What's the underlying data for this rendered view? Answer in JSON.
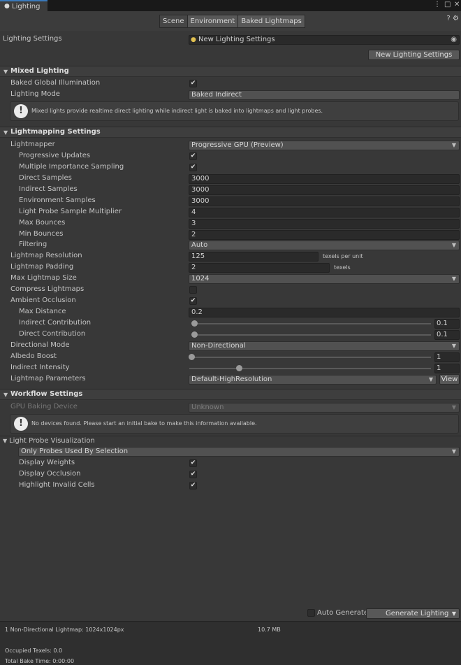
{
  "window": {
    "tab_title": "Lighting",
    "controls": [
      "⋮",
      "□",
      "✕"
    ]
  },
  "toolbar": {
    "tabs": [
      "Scene",
      "Environment",
      "Baked Lightmaps"
    ],
    "active": 0,
    "help_icon": "?",
    "settings_icon": "⚙"
  },
  "lighting_settings": {
    "label": "Lighting Settings",
    "value": "New Lighting Settings",
    "new_button": "New Lighting Settings"
  },
  "mixed": {
    "title": "Mixed Lighting",
    "baked_gi_label": "Baked Global Illumination",
    "baked_gi_checked": "✔",
    "mode_label": "Lighting Mode",
    "mode_value": "Baked Indirect",
    "help": "Mixed lights provide realtime direct lighting while indirect light is baked into lightmaps and light probes."
  },
  "lightmapping": {
    "title": "Lightmapping Settings",
    "lightmapper_label": "Lightmapper",
    "lightmapper_value": "Progressive GPU (Preview)",
    "progressive_label": "Progressive Updates",
    "progressive_checked": "✔",
    "mis_label": "Multiple Importance Sampling",
    "mis_checked": "✔",
    "direct_samples_label": "Direct Samples",
    "direct_samples": "3000",
    "indirect_samples_label": "Indirect Samples",
    "indirect_samples": "3000",
    "env_samples_label": "Environment Samples",
    "env_samples": "3000",
    "probe_mult_label": "Light Probe Sample Multiplier",
    "probe_mult": "4",
    "max_bounces_label": "Max Bounces",
    "max_bounces": "3",
    "min_bounces_label": "Min Bounces",
    "min_bounces": "2",
    "filtering_label": "Filtering",
    "filtering_value": "Auto",
    "resolution_label": "Lightmap Resolution",
    "resolution": "125",
    "resolution_unit": "texels per unit",
    "padding_label": "Lightmap Padding",
    "padding": "2",
    "padding_unit": "texels",
    "max_size_label": "Max Lightmap Size",
    "max_size": "1024",
    "compress_label": "Compress Lightmaps",
    "compress_checked": "",
    "ao_label": "Ambient Occlusion",
    "ao_checked": "✔",
    "max_distance_label": "Max Distance",
    "max_distance": "0.2",
    "indirect_contrib_label": "Indirect Contribution",
    "indirect_contrib": "0.1",
    "direct_contrib_label": "Direct Contribution",
    "direct_contrib": "0.1",
    "directional_label": "Directional Mode",
    "directional_value": "Non-Directional",
    "albedo_label": "Albedo Boost",
    "albedo": "1",
    "intensity_label": "Indirect Intensity",
    "intensity": "1",
    "params_label": "Lightmap Parameters",
    "params_value": "Default-HighResolution",
    "view_button": "View"
  },
  "workflow": {
    "title": "Workflow Settings",
    "gpu_label": "GPU Baking Device",
    "gpu_value": "Unknown",
    "help": "No devices found. Please start an initial bake to make this information available."
  },
  "probe_vis": {
    "title": "Light Probe Visualization",
    "mode_value": "Only Probes Used By Selection",
    "weights_label": "Display Weights",
    "weights_checked": "✔",
    "occlusion_label": "Display Occlusion",
    "occlusion_checked": "✔",
    "invalid_label": "Highlight Invalid Cells",
    "invalid_checked": "✔"
  },
  "footer": {
    "auto_generate_label": "Auto Generate",
    "generate_button": "Generate Lighting",
    "lightmap_info": "1 Non-Directional Lightmap: 1024x1024px",
    "size": "10.7 MB",
    "occupied": "Occupied Texels: 0.0",
    "bake_time": "Total Bake Time: 0:00:00"
  }
}
